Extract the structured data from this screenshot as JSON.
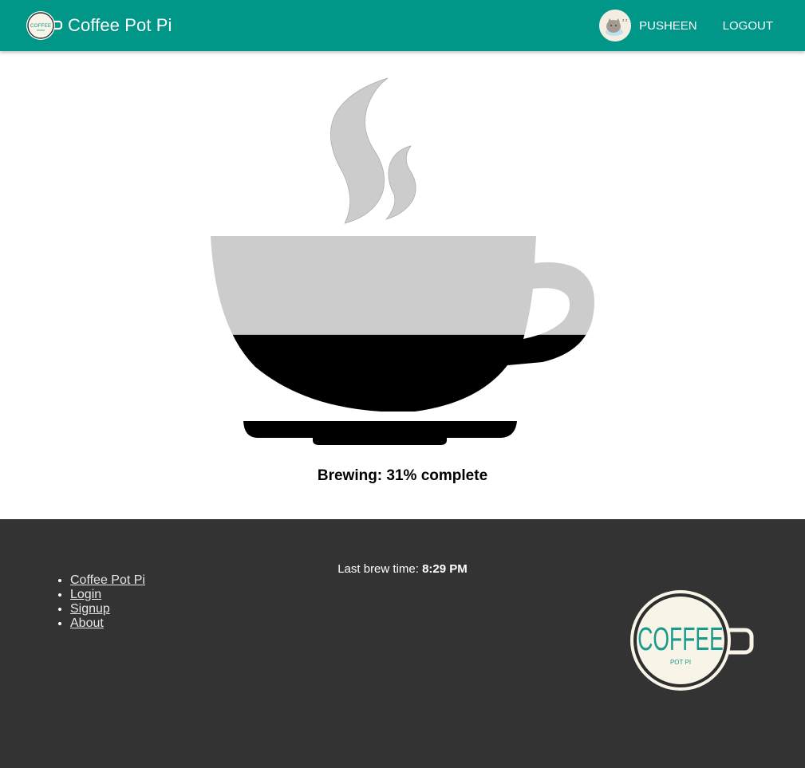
{
  "header": {
    "brand_title": "Coffee Pot Pi",
    "logo_text": "COFFEE",
    "username": "PUSHEEN",
    "logout_label": "LOGOUT"
  },
  "main": {
    "brew_status": "Brewing: 31% complete",
    "brew_progress_percent": 31
  },
  "footer": {
    "links": [
      {
        "label": "Coffee Pot Pi"
      },
      {
        "label": "Login"
      },
      {
        "label": "Signup"
      },
      {
        "label": "About"
      }
    ],
    "last_brew_label": "Last brew time:",
    "last_brew_time": "8:29 PM",
    "logo_main": "COFFEE",
    "logo_sub": "POT PI"
  },
  "colors": {
    "nav_bg": "#009688",
    "footer_bg": "#333333",
    "cup_empty": "#cccccc",
    "coffee_fill": "#000000",
    "logo_teal": "#1a9a8c"
  }
}
